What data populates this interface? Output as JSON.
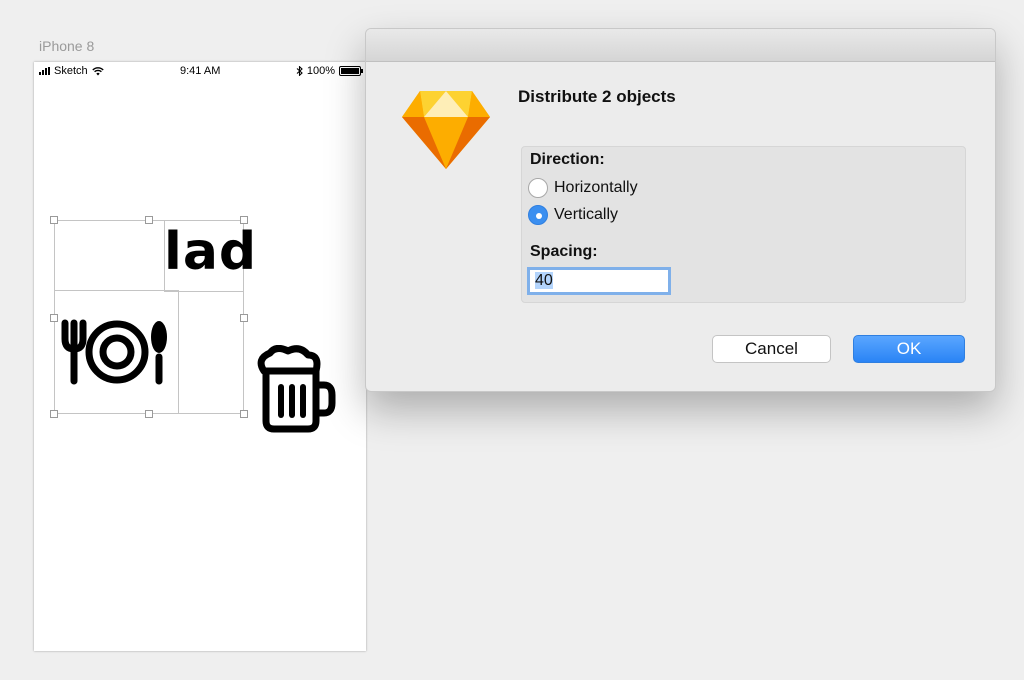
{
  "artboard": {
    "name": "iPhone 8",
    "status": {
      "carrier": "Sketch",
      "time": "9:41 AM",
      "battery": "100%"
    }
  },
  "canvas": {
    "text_layer": "lad"
  },
  "dialog": {
    "title": "Distribute 2 objects",
    "direction_label": "Direction:",
    "options": [
      {
        "label": "Horizontally",
        "selected": false
      },
      {
        "label": "Vertically",
        "selected": true
      }
    ],
    "spacing_label": "Spacing:",
    "spacing_value": "40",
    "cancel_label": "Cancel",
    "ok_label": "OK",
    "accent": "#3b8ff0"
  }
}
